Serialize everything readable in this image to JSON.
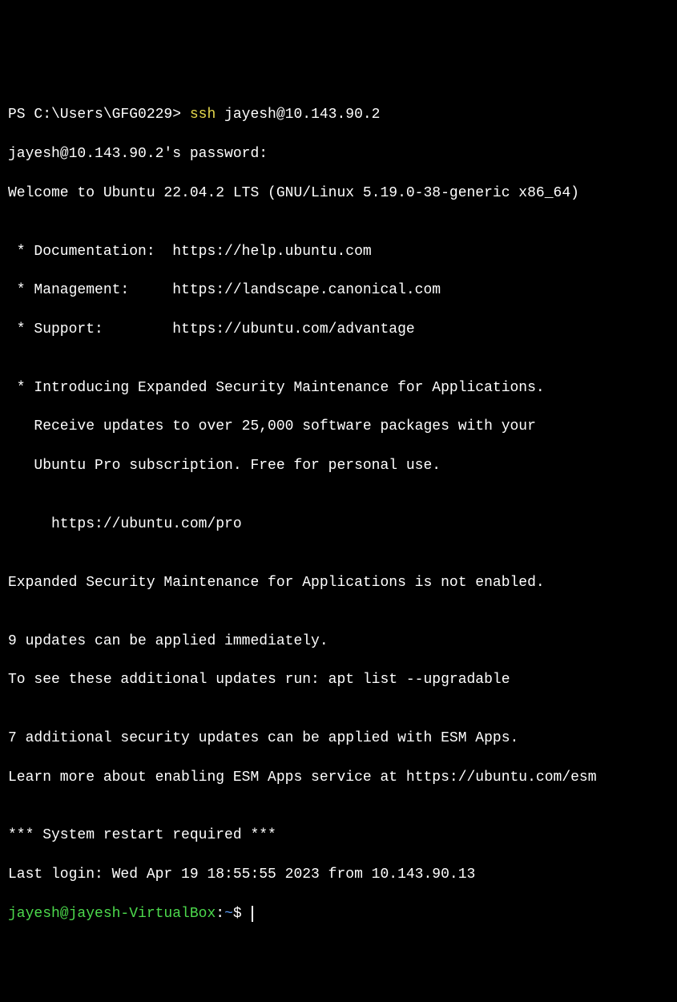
{
  "ps_prompt": "PS C:\\Users\\GFG0229> ",
  "ssh_cmd": "ssh",
  "ssh_args": " jayesh@10.143.90.2",
  "pw_line": "jayesh@10.143.90.2's password:",
  "welcome": "Welcome to Ubuntu 22.04.2 LTS (GNU/Linux 5.19.0-38-generic x86_64)",
  "blank": "",
  "doc": " * Documentation:  https://help.ubuntu.com",
  "mgmt": " * Management:     https://landscape.canonical.com",
  "supp": " * Support:        https://ubuntu.com/advantage",
  "esm1": " * Introducing Expanded Security Maintenance for Applications.",
  "esm2": "   Receive updates to over 25,000 software packages with your",
  "esm3": "   Ubuntu Pro subscription. Free for personal use.",
  "prolink": "     https://ubuntu.com/pro",
  "esmoff": "Expanded Security Maintenance for Applications is not enabled.",
  "updates1": "9 updates can be applied immediately.",
  "updates2": "To see these additional updates run: apt list --upgradable",
  "sec1": "7 additional security updates can be applied with ESM Apps.",
  "sec2": "Learn more about enabling ESM Apps service at https://ubuntu.com/esm",
  "restart": "*** System restart required ***",
  "lastlogin": "Last login: Wed Apr 19 18:55:55 2023 from 10.143.90.13",
  "prompt_user": "jayesh@jayesh-VirtualBox",
  "prompt_colon": ":",
  "prompt_path": "~",
  "prompt_dollar": "$ "
}
